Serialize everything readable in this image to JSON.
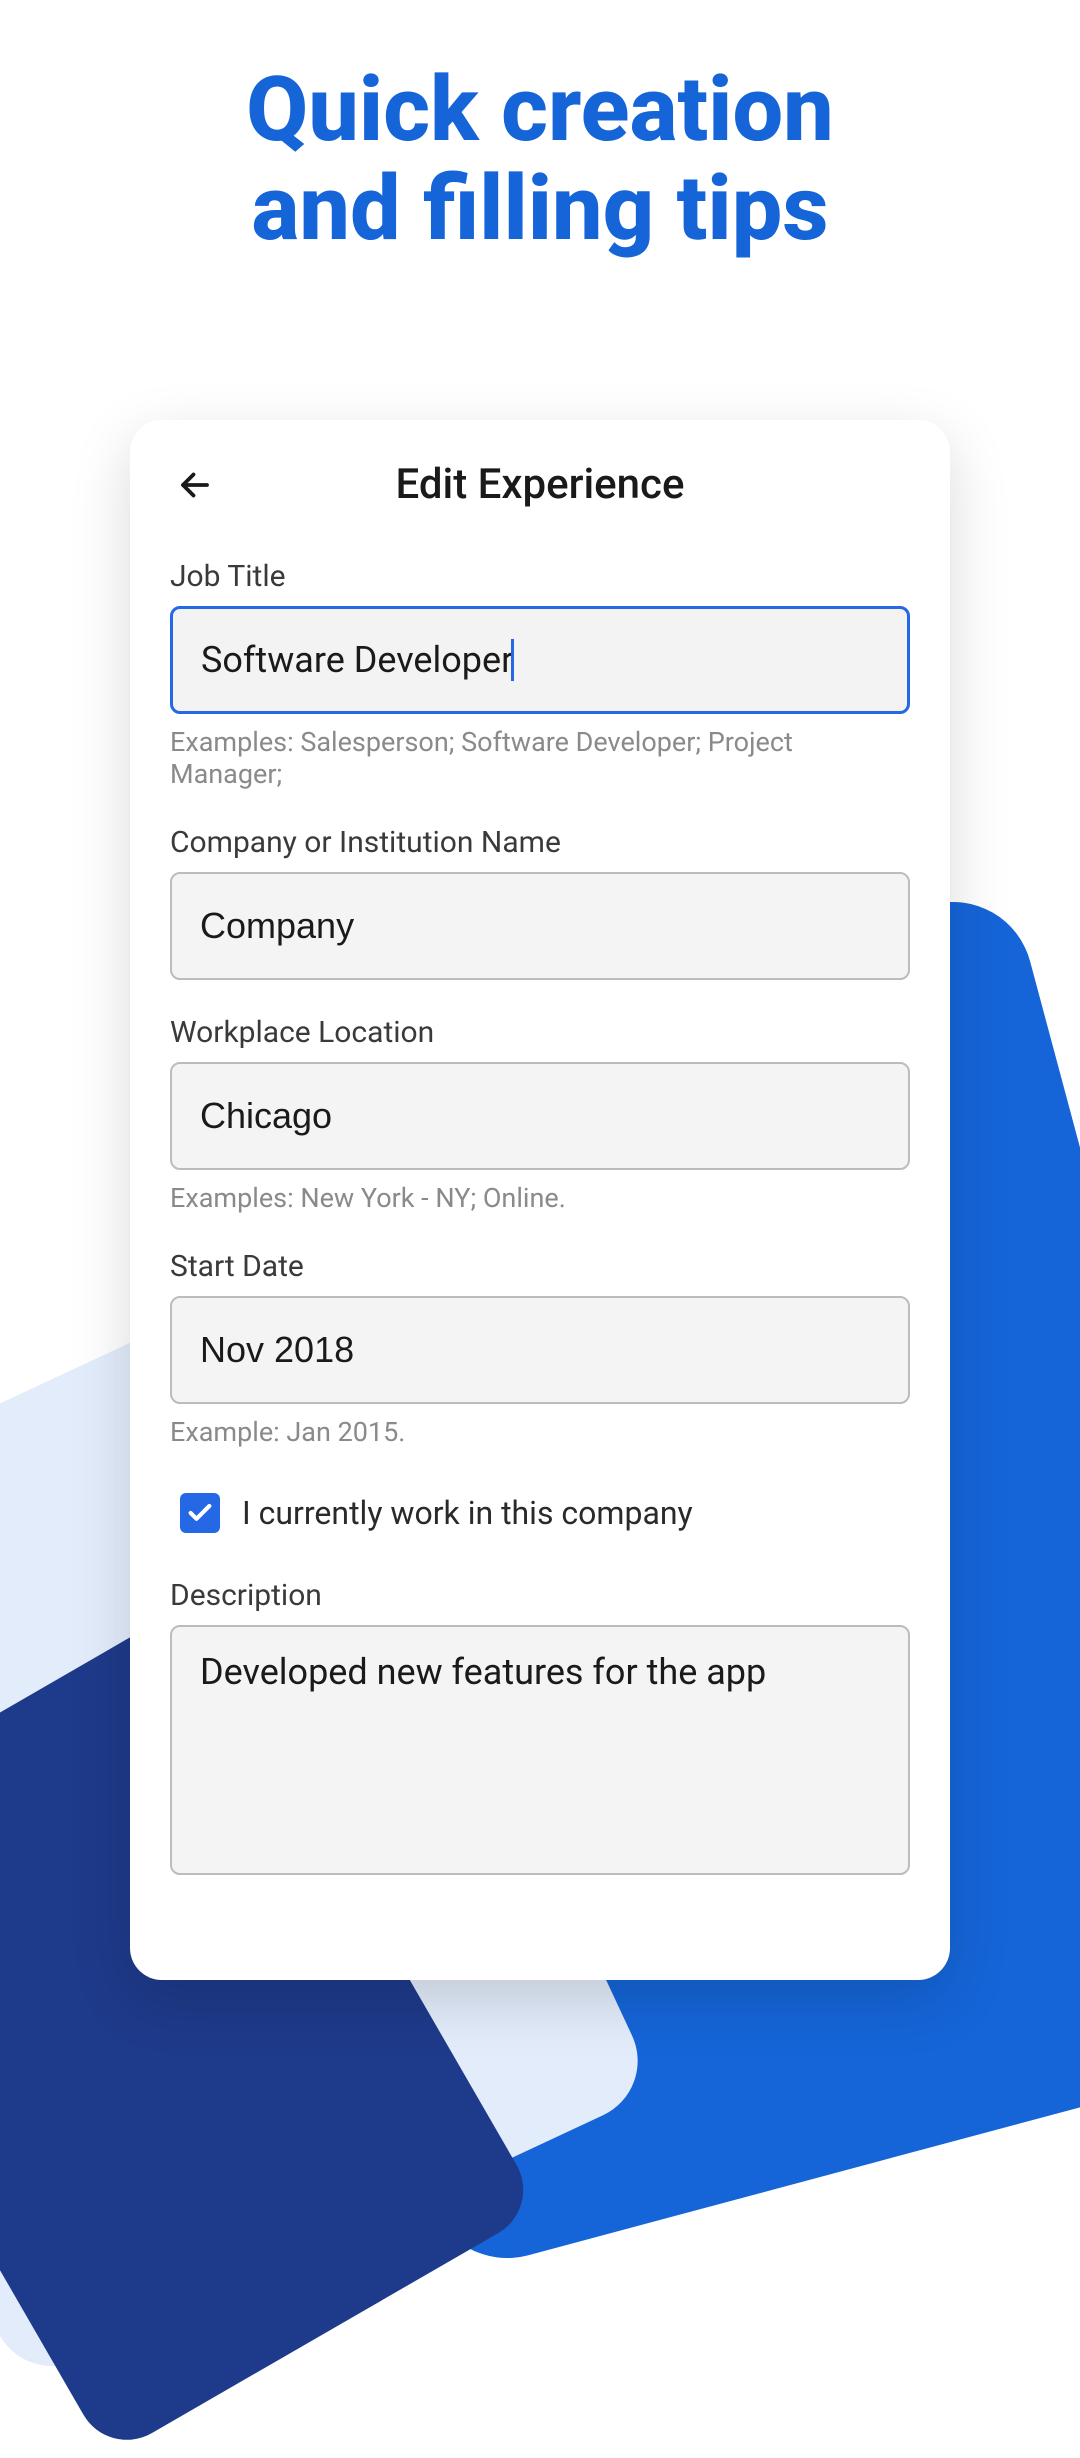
{
  "hero": {
    "title_line1": "Quick creation",
    "title_line2": "and filling tips"
  },
  "card": {
    "title": "Edit Experience",
    "fields": {
      "job_title": {
        "label": "Job Title",
        "value": "Software Developer",
        "hint": "Examples: Salesperson; Software Developer; Project Manager;"
      },
      "company": {
        "label": "Company or Institution Name",
        "value": "Company"
      },
      "location": {
        "label": "Workplace Location",
        "value": "Chicago",
        "hint": "Examples: New York - NY; Online."
      },
      "start_date": {
        "label": "Start Date",
        "value": "Nov 2018",
        "hint": "Example: Jan 2015."
      },
      "current_work": {
        "label": "I currently work in this company",
        "checked": true
      },
      "description": {
        "label": "Description",
        "value": "Developed new features for the app"
      }
    }
  }
}
